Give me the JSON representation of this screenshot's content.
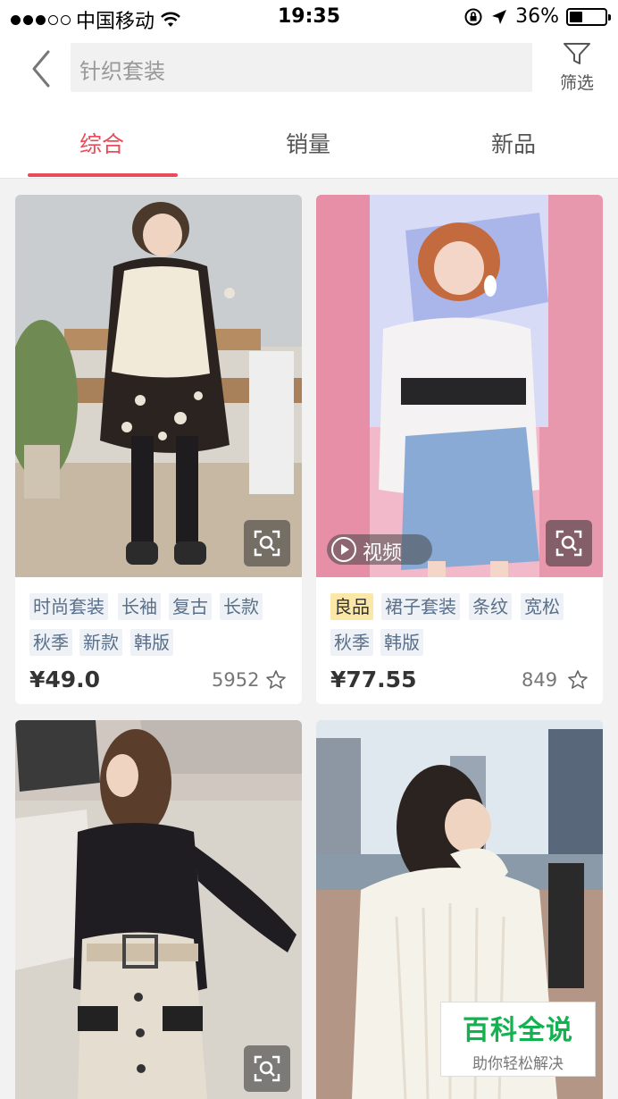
{
  "status_bar": {
    "carrier": "中国移动",
    "time": "19:35",
    "battery": "36%",
    "battery_level": 0.36
  },
  "header": {
    "search_value": "针织套装",
    "filter_label": "筛选"
  },
  "tabs": [
    {
      "label": "综合"
    },
    {
      "label": "销量"
    },
    {
      "label": "新品"
    }
  ],
  "products": [
    {
      "tags": [
        "时尚套装",
        "长袖",
        "复古",
        "长款",
        "秋季",
        "新款",
        "韩版"
      ],
      "price": "¥49.0",
      "sales": "5952"
    },
    {
      "video_label": "视频",
      "tags": [
        "良品",
        "裙子套装",
        "条纹",
        "宽松",
        "秋季",
        "韩版"
      ],
      "price": "¥77.55",
      "sales": "849"
    },
    {},
    {}
  ],
  "watermark": {
    "title": "百科全说",
    "subtitle": "助你轻松解决"
  },
  "colors": {
    "accent": "#ec4a5a",
    "tag_text": "#5a6f8a",
    "tag_bg": "#eef2f6",
    "highlight_tag_bg": "#fbe7a8",
    "watermark_green": "#12b34f"
  }
}
